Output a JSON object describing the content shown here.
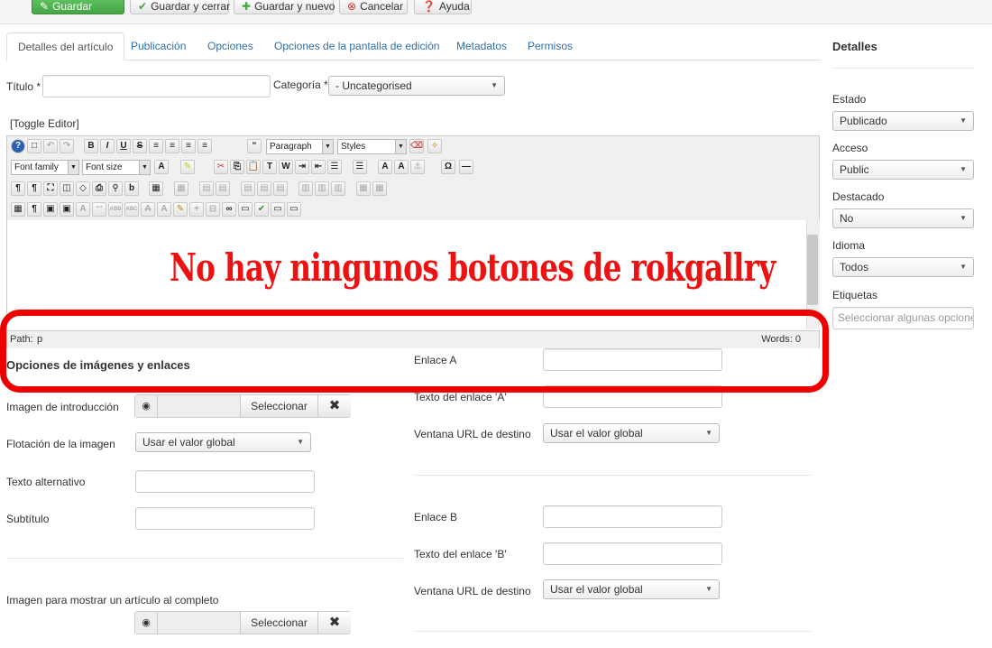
{
  "toolbar": {
    "save": "Guardar",
    "save_close": "Guardar y cerrar",
    "save_new": "Guardar y nuevo",
    "cancel": "Cancelar",
    "help": "Ayuda"
  },
  "tabs": [
    "Detalles del artículo",
    "Publicación",
    "Opciones",
    "Opciones de la pantalla de edición",
    "Metadatos",
    "Permisos"
  ],
  "form": {
    "title_label": "Título *",
    "category_label": "Categoría *",
    "category_value": "- Uncategorised",
    "toggle_editor": "[Toggle Editor]"
  },
  "editor": {
    "format_select": "Paragraph",
    "styles_select": "Styles",
    "font_family": "Font family",
    "font_size": "Font size",
    "path_label": "Path:",
    "path_value": "p",
    "words": "Words: 0"
  },
  "annotation": "No hay ningunos botones de rokgallry",
  "images": {
    "section_title": "Opciones de imágenes y enlaces",
    "intro_image_label": "Imagen de introducción",
    "select_label": "Seleccionar",
    "clear_symbol": "✖",
    "float_label": "Flotación de la imagen",
    "float_value": "Usar el valor global",
    "alt_label": "Texto alternativo",
    "caption_label": "Subtítulo",
    "full_image_label": "Imagen para mostrar un artículo al completo"
  },
  "links": {
    "link_a_label": "Enlace A",
    "link_a_text_label": "Texto del enlace 'A'",
    "link_a_target_label": "Ventana URL de destino",
    "link_a_target_value": "Usar el valor global",
    "link_b_label": "Enlace B",
    "link_b_text_label": "Texto del enlace 'B'",
    "link_b_target_label": "Ventana URL de destino",
    "link_b_target_value": "Usar el valor global"
  },
  "sidebar": {
    "title": "Detalles",
    "state_label": "Estado",
    "state_value": "Publicado",
    "access_label": "Acceso",
    "access_value": "Public",
    "featured_label": "Destacado",
    "featured_value": "No",
    "language_label": "Idioma",
    "language_value": "Todos",
    "tags_label": "Etiquetas",
    "tags_placeholder": "Seleccionar algunas opciones"
  },
  "colors": {
    "annotation_red": "#ee1111",
    "link_blue": "#3071a9",
    "save_green": "#46a546"
  }
}
